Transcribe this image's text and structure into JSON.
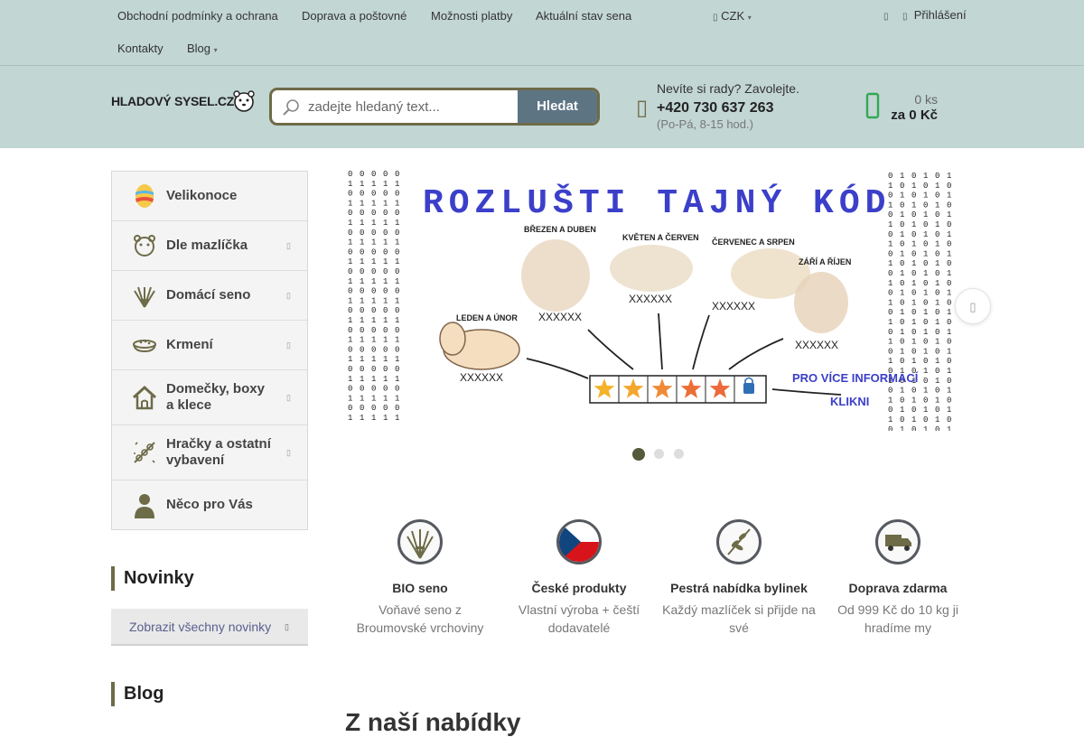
{
  "topnav": {
    "links": [
      "Obchodní podmínky a ochrana",
      "Doprava a poštovné",
      "Možnosti platby",
      "Aktuální stav sena",
      "Kontakty",
      "Blog"
    ],
    "currency": "CZK",
    "login": "Přihlášení"
  },
  "header": {
    "logo_text": "HLADOVÝ SYSEL.CZ",
    "search_placeholder": "zadejte hledaný text...",
    "search_button": "Hledat",
    "help_question": "Nevíte si rady? Zavolejte.",
    "phone": "+420 730 637 263",
    "hours": "(Po-Pá, 8-15 hod.)",
    "cart_count": "0 ks",
    "cart_total": "za 0 Kč"
  },
  "sidebar": {
    "items": [
      {
        "label": "Velikonoce",
        "icon": "easter-egg-icon"
      },
      {
        "label": "Dle mazlíčka",
        "icon": "hamster-icon"
      },
      {
        "label": "Domácí seno",
        "icon": "hay-icon"
      },
      {
        "label": "Krmení",
        "icon": "food-bowl-icon"
      },
      {
        "label": "Domečky, boxy a klece",
        "icon": "house-icon"
      },
      {
        "label": "Hračky a ostatní vybavení",
        "icon": "toy-icon"
      },
      {
        "label": "Něco pro Vás",
        "icon": "person-icon"
      }
    ]
  },
  "news": {
    "title": "Novinky",
    "show_all": "Zobrazit všechny novinky"
  },
  "blog": {
    "title": "Blog"
  },
  "banner": {
    "headline": "ROZLUŠTI TAJNÝ KÓD",
    "months": [
      "LEDEN A ÚNOR",
      "BŘEZEN A DUBEN",
      "KVĚTEN A ČERVEN",
      "ČERVENEC A SRPEN",
      "ZÁŘÍ A ŘÍJEN"
    ],
    "codes": [
      "XXXXXX",
      "XXXXXX",
      "XXXXXX",
      "XXXXXX",
      "XXXXXX"
    ],
    "info_line1": "PRO VÍCE INFORMACÍ",
    "info_line2": "KLIKNI",
    "slide_index": 1,
    "slide_count": 3
  },
  "features": [
    {
      "title": "BIO seno",
      "desc": "Voňavé seno z Broumovské vrchoviny",
      "icon": "hay-icon"
    },
    {
      "title": "České produkty",
      "desc": "Vlastní výroba + čeští dodavatelé",
      "icon": "czech-flag-icon"
    },
    {
      "title": "Pestrá nabídka bylinek",
      "desc": "Každý mazlíček si přijde na své",
      "icon": "herb-icon"
    },
    {
      "title": "Doprava zdarma",
      "desc": "Od 999 Kč do 10 kg ji hradíme my",
      "icon": "truck-icon"
    }
  ],
  "section": {
    "our_offer": "Z naší nabídky"
  },
  "colors": {
    "header_bg": "#c2d6d4",
    "accent": "#6e6b48",
    "button": "#5d7483"
  }
}
